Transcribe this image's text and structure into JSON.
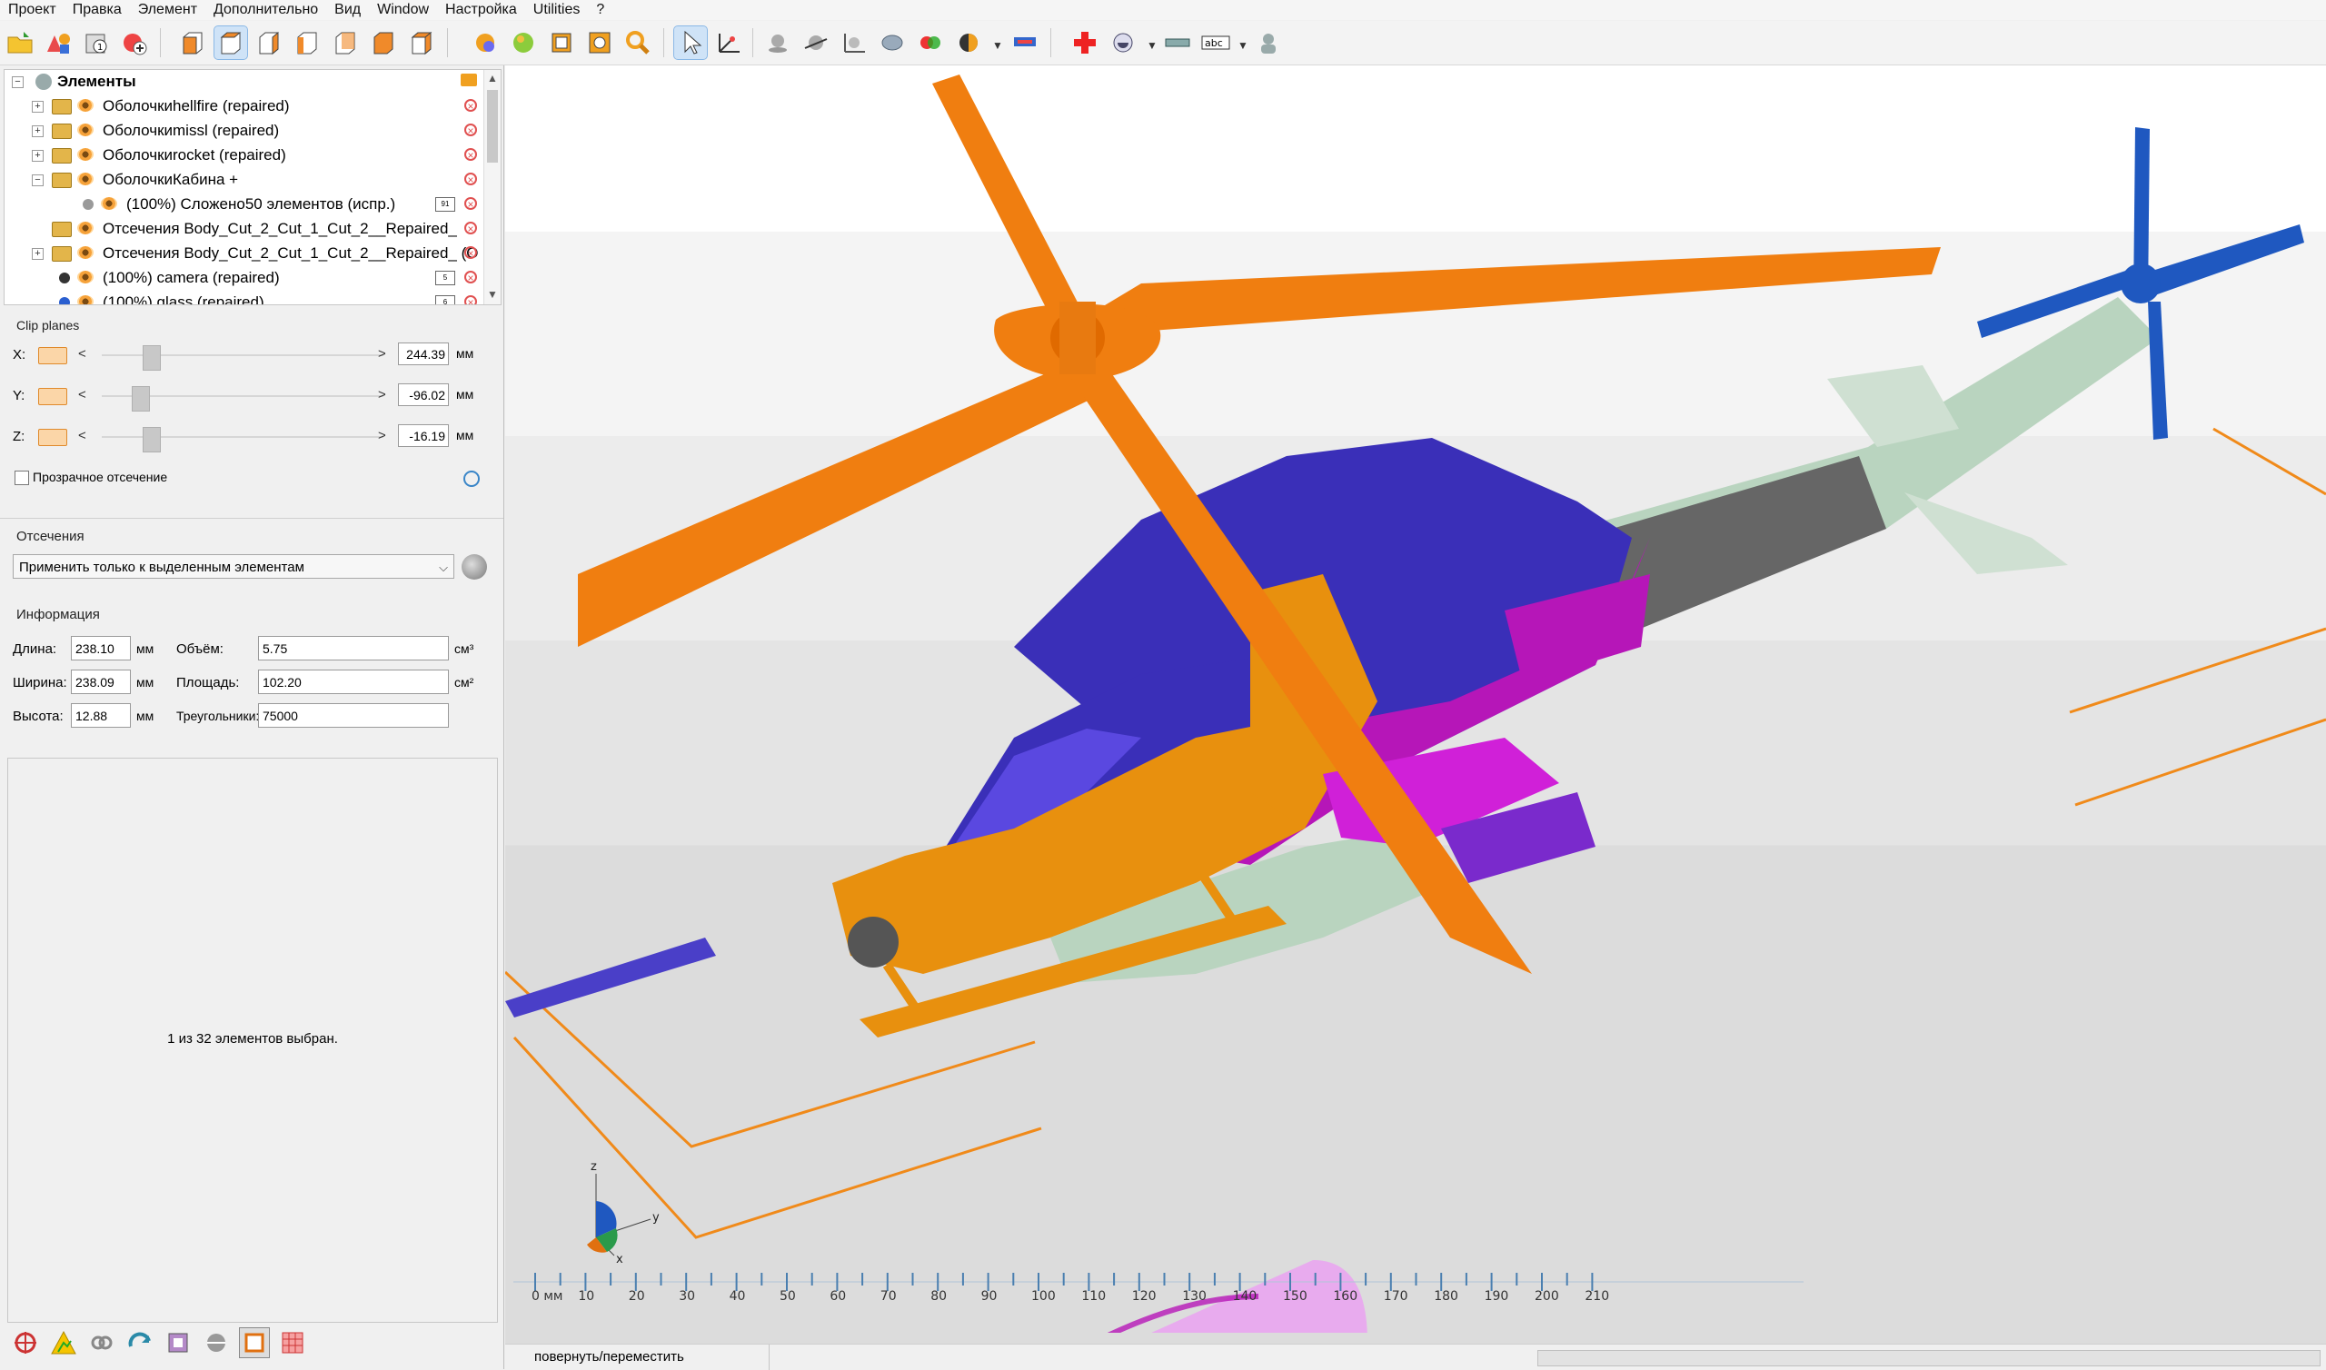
{
  "menu": {
    "items": [
      "Проект",
      "Правка",
      "Элемент",
      "Дополнительно",
      "Вид",
      "Window",
      "Настройка",
      "Utilities",
      "?"
    ]
  },
  "tree": {
    "root_label": "Элементы",
    "items": [
      {
        "label": "Оболочкиhellfire (repaired)"
      },
      {
        "label": "Оболочкиmissl (repaired)"
      },
      {
        "label": "Оболочкиrocket (repaired)"
      },
      {
        "label": "ОболочкиКабина +"
      },
      {
        "label": "(100%) Сложено50 элементов (испр.)",
        "badge": "91"
      },
      {
        "label": "Отсечения Body_Cut_2_Cut_1_Cut_2__Repaired_"
      },
      {
        "label": "Отсечения Body_Cut_2_Cut_1_Cut_2__Repaired_ (O"
      },
      {
        "label": "(100%) camera (repaired)",
        "badge": "5"
      },
      {
        "label": "(100%) glass (repaired)",
        "badge": "6"
      }
    ]
  },
  "clip": {
    "title": "Clip planes",
    "rows": [
      {
        "axis": "X:",
        "value": "244.39",
        "unit": "мм",
        "level": 0.15
      },
      {
        "axis": "Y:",
        "value": "-96.02",
        "unit": "мм",
        "level": 0.11
      },
      {
        "axis": "Z:",
        "value": "-16.19",
        "unit": "мм",
        "level": 0.15
      }
    ],
    "transparent_label": "Прозрачное отсечение"
  },
  "cuts": {
    "title": "Отсечения",
    "dropdown_value": "Применить только к выделенным элементам"
  },
  "info": {
    "title": "Информация",
    "length_label": "Длина:",
    "length_value": "238.10",
    "length_unit": "мм",
    "width_label": "Ширина:",
    "width_value": "238.09",
    "width_unit": "мм",
    "height_label": "Высота:",
    "height_value": "12.88",
    "height_unit": "мм",
    "volume_label": "Объём:",
    "volume_value": "5.75",
    "volume_unit": "см³",
    "area_label": "Площадь:",
    "area_value": "102.20",
    "area_unit": "см²",
    "triangles_label": "Треугольники:",
    "triangles_value": "75000"
  },
  "selection_status": "1 из 32 элементов выбран.",
  "ruler": {
    "zero_label": "0 мм",
    "labels": [
      "10",
      "20",
      "30",
      "40",
      "50",
      "60",
      "70",
      "80",
      "90",
      "100",
      "110",
      "120",
      "130",
      "140",
      "150",
      "160",
      "170",
      "180",
      "190",
      "200",
      "210"
    ]
  },
  "axes_labels": {
    "z": "z",
    "y": "y",
    "x": "x"
  },
  "status_bar": {
    "mode_text": "повернуть/переместить"
  },
  "colors": {
    "rotor": "#f07e10",
    "body_blue": "#3a2fb8",
    "body_magenta": "#b616b8",
    "cockpit_orange": "#e8900e",
    "body_pale": "#b9d4bf",
    "tail_gray": "#666666",
    "tail_rotor_blue": "#1f58c0"
  },
  "icons": {
    "toolbar": [
      "open-icon",
      "shapes-icon",
      "measure-icon",
      "add-part-icon",
      "view-front-icon",
      "view-top-icon",
      "view-left-icon",
      "view-right-icon",
      "view-back-icon",
      "view-bottom-icon",
      "view-iso-icon",
      "sphere-orange-icon",
      "sphere-green-icon",
      "fit-icon",
      "zoom-fit-icon",
      "search-zoom-icon",
      "select-arrow-icon",
      "pivot-icon",
      "drop-icon",
      "cut-plane-icon",
      "section-icon",
      "rotate-icon",
      "color-icon",
      "render-icon",
      "texture-icon",
      "add-red-icon",
      "shading-icon",
      "ruler-icon",
      "text-label-icon",
      "person-icon"
    ],
    "bottom": [
      "move-tool-icon",
      "warning-icon",
      "link-icon",
      "repair-icon",
      "box-icon",
      "layers-icon",
      "frame-icon",
      "grid-icon"
    ]
  }
}
